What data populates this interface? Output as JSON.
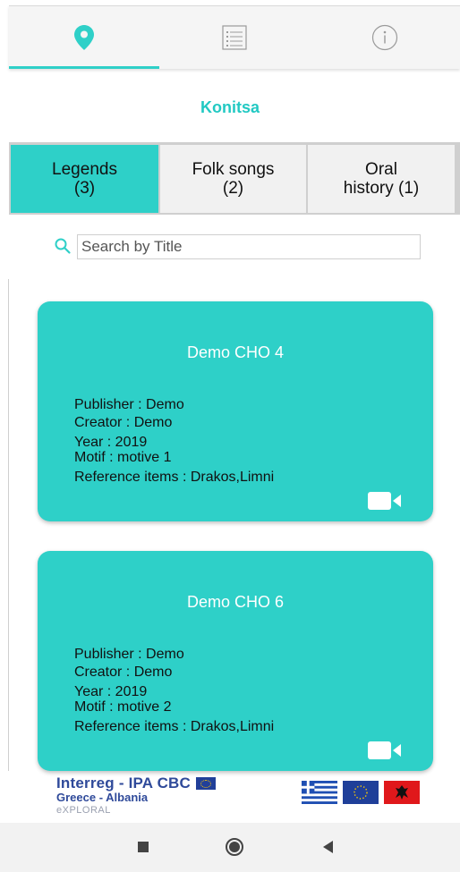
{
  "header": {
    "tabs": [
      {
        "icon": "map-pin-icon",
        "active": true
      },
      {
        "icon": "list-icon",
        "active": false
      },
      {
        "icon": "info-icon",
        "active": false
      }
    ],
    "accent_color": "#2fd0c8"
  },
  "place": {
    "title": "Konitsa"
  },
  "categories": [
    {
      "line1": "Legends",
      "line2": "(3)",
      "active": true
    },
    {
      "line1": "Folk songs",
      "line2": "(2)",
      "active": false
    },
    {
      "line1": "Oral",
      "line2": "history (1)",
      "active": false
    }
  ],
  "search": {
    "placeholder": "Search by Title",
    "value": ""
  },
  "cards": [
    {
      "title": "Demo CHO 4",
      "publisher": "Publisher : Demo",
      "creator": "Creator : Demo",
      "year": "Year : 2019",
      "motif": "Motif : motive 1",
      "reference": "Reference items : Drakos,Limni",
      "icon": "video-camera-icon"
    },
    {
      "title": "Demo CHO 6",
      "publisher": "Publisher : Demo",
      "creator": "Creator : Demo",
      "year": "Year : 2019",
      "motif": "Motif : motive 2",
      "reference": "Reference items : Drakos,Limni",
      "icon": "video-camera-icon"
    }
  ],
  "footer": {
    "program": "Interreg - IPA CBC",
    "region": "Greece - Albania",
    "project": "eXPLORAL",
    "flags": [
      "greece-flag",
      "eu-flag",
      "albania-flag"
    ]
  },
  "navbar": {
    "buttons": [
      "recents-button",
      "home-button",
      "back-button"
    ]
  },
  "colors": {
    "card": "#2ed0c8",
    "title": "#22c9c3",
    "tab_bg": "#f1f1f1"
  }
}
